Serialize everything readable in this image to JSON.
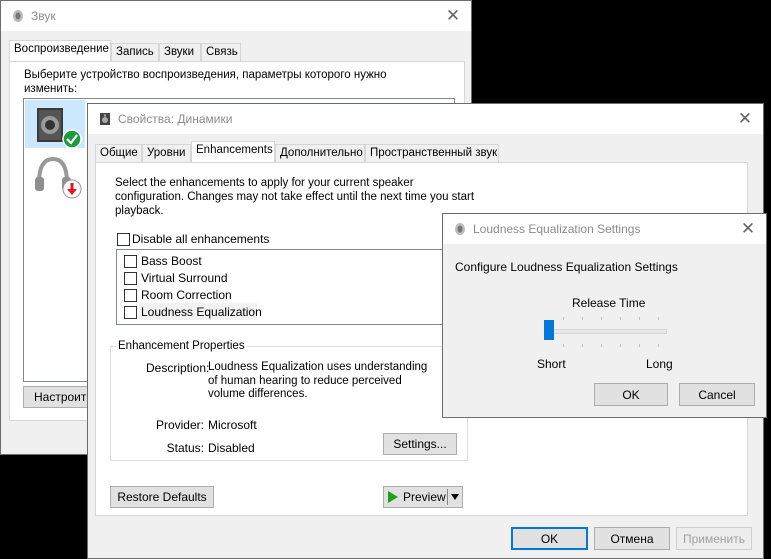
{
  "sound_window": {
    "title": "Звук",
    "tabs": [
      "Воспроизведение",
      "Запись",
      "Звуки",
      "Связь"
    ],
    "description": "Выберите устройство воспроизведения, параметры которого нужно изменить:",
    "configure_button": "Настроить"
  },
  "properties_window": {
    "title": "Свойства: Динамики",
    "tabs": [
      "Общие",
      "Уровни",
      "Enhancements",
      "Дополнительно",
      "Пространственный звук"
    ],
    "intro": "Select the enhancements to apply for your current speaker configuration. Changes may not take effect until the next time you start playback.",
    "disable_all_label": "Disable all enhancements",
    "disable_all_checked": false,
    "enhancements": [
      {
        "label": "Bass Boost",
        "checked": false
      },
      {
        "label": "Virtual Surround",
        "checked": false
      },
      {
        "label": "Room Correction",
        "checked": false
      },
      {
        "label": "Loudness Equalization",
        "checked": false
      }
    ],
    "group_title": "Enhancement Properties",
    "description_label": "Description:",
    "description_value": "Loudness Equalization uses understanding of human hearing to reduce perceived volume differences.",
    "provider_label": "Provider:",
    "provider_value": "Microsoft",
    "status_label": "Status:",
    "status_value": "Disabled",
    "settings_button": "Settings...",
    "restore_button": "Restore Defaults",
    "preview_button": "Preview",
    "ok_button": "OK",
    "cancel_button": "Отмена",
    "apply_button": "Применить"
  },
  "loudness_dialog": {
    "title": "Loudness Equalization Settings",
    "heading": "Configure Loudness Equalization Settings",
    "slider_label": "Release Time",
    "slider_min_label": "Short",
    "slider_max_label": "Long",
    "slider_value": 0,
    "ok_button": "OK",
    "cancel_button": "Cancel"
  },
  "colors": {
    "accent": "#0078d7",
    "green_check": "#1e9b3c",
    "red_badge": "#e81123"
  }
}
